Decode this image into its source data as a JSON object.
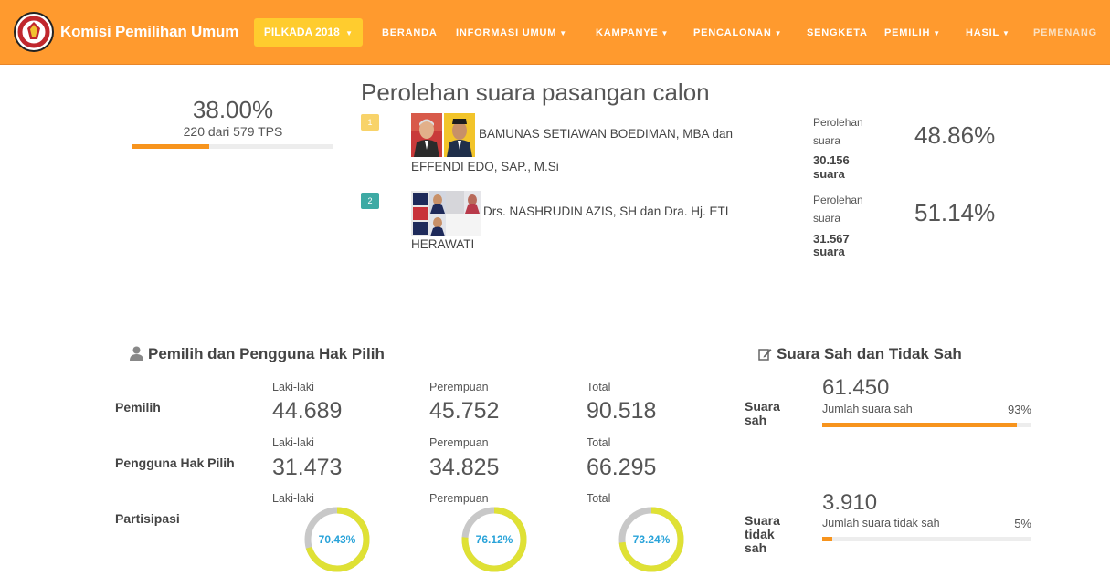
{
  "header": {
    "brand": "Komisi Pemilihan Umum",
    "pilkada_label": "PILKADA 2018",
    "nav": [
      "BERANDA",
      "INFORMASI UMUM",
      "KAMPANYE",
      "PENCALONAN",
      "SENGKETA",
      "PEMILIH",
      "HASIL",
      "PEMENANG"
    ],
    "colors": {
      "bar": "#ff9a2e",
      "pilkada_button": "#ffcc2e"
    }
  },
  "tps": {
    "percent": "38.00%",
    "detail": "220 dari 579 TPS",
    "progress": 0.38
  },
  "results": {
    "title": "Perolehan suara pasangan calon",
    "candidates": [
      {
        "number": "1",
        "badge_color": "#f8d36a",
        "name_line1": "BAMUNAS SETIAWAN BOEDIMAN, MBA dan",
        "name_line2": "EFFENDI EDO, SAP., M.Si",
        "vote_label_1": "Perolehan",
        "vote_label_2": "suara",
        "votes": "30.156",
        "votes_unit": "suara",
        "percent": "48.86%"
      },
      {
        "number": "2",
        "badge_color": "#3daaa4",
        "name_line1": "Drs. NASHRUDIN AZIS, SH dan Dra. Hj. ETI",
        "name_line2": "HERAWATI",
        "vote_label_1": "Perolehan",
        "vote_label_2": "suara",
        "votes": "31.567",
        "votes_unit": "suara",
        "percent": "51.14%"
      }
    ]
  },
  "voters": {
    "title": "Pemilih dan Pengguna Hak Pilih",
    "icon": "user-icon",
    "rows": [
      {
        "label": "Pemilih",
        "col_labels": [
          "Laki-laki",
          "Perempuan",
          "Total"
        ],
        "values": [
          "44.689",
          "45.752",
          "90.518"
        ]
      },
      {
        "label": "Pengguna Hak Pilih",
        "col_labels": [
          "Laki-laki",
          "Perempuan",
          "Total"
        ],
        "values": [
          "31.473",
          "34.825",
          "66.295"
        ]
      }
    ],
    "participation": {
      "label": "Partisipasi",
      "col_labels": [
        "Laki-laki",
        "Perempuan",
        "Total"
      ],
      "values": [
        "70.43%",
        "76.12%",
        "73.24%"
      ],
      "fractions": [
        0.7043,
        0.7612,
        0.7324
      ],
      "ring_color": "#dfe135",
      "track_color": "#c8c8c8"
    }
  },
  "validity": {
    "title": "Suara Sah dan Tidak Sah",
    "icon": "edit-icon",
    "valid": {
      "label_lines": [
        "Suara",
        "sah"
      ],
      "count": "61.450",
      "desc": "Jumlah suara sah",
      "percent": "93%",
      "fraction": 0.93
    },
    "invalid": {
      "label_lines": [
        "Suara",
        "tidak",
        "sah"
      ],
      "count": "3.910",
      "desc": "Jumlah suara tidak sah",
      "percent": "5%",
      "fraction": 0.05
    }
  }
}
